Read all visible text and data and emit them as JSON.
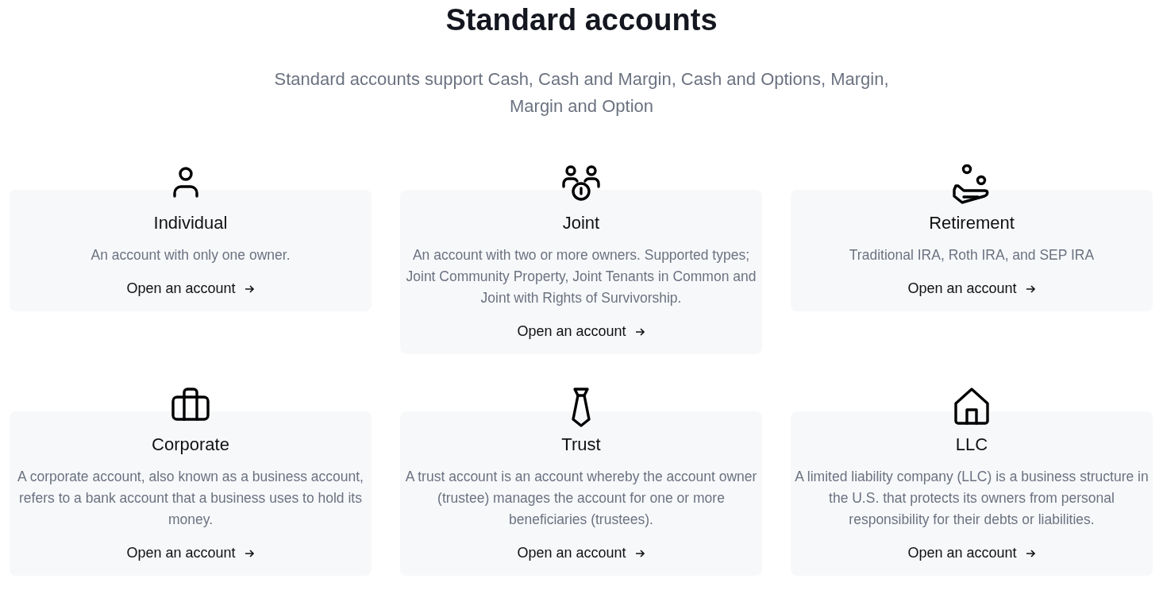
{
  "heading": "Standard accounts",
  "subtitle": "Standard accounts support Cash, Cash and Margin, Cash and Options, Margin, Margin and Option",
  "cards": [
    {
      "kind": "person",
      "title": "Individual",
      "description": "An account with only one owner.",
      "link": "Open an account"
    },
    {
      "kind": "group",
      "title": "Joint",
      "description": "An account with two or more owners. Supported types; Joint Community Property, Joint Tenants in Common and Joint with Rights of Survivorship.",
      "link": "Open an account"
    },
    {
      "kind": "hand",
      "title": "Retirement",
      "description": "Traditional IRA, Roth IRA, and SEP IRA",
      "link": "Open an account"
    },
    {
      "kind": "briefcase",
      "title": "Corporate",
      "description": "A corporate account, also known as a business account, refers to a bank account that a business uses to hold its money.",
      "link": "Open an account"
    },
    {
      "kind": "tie",
      "title": "Trust",
      "description": "A trust account is an account whereby the account owner (trustee) manages the account for one or more beneficiaries (trustees).",
      "link": "Open an account"
    },
    {
      "kind": "house",
      "title": "LLC",
      "description": "A limited liability company (LLC) is a business structure in the U.S. that protects its owners from personal responsibility for their debts or liabilities.",
      "link": "Open an account"
    }
  ]
}
